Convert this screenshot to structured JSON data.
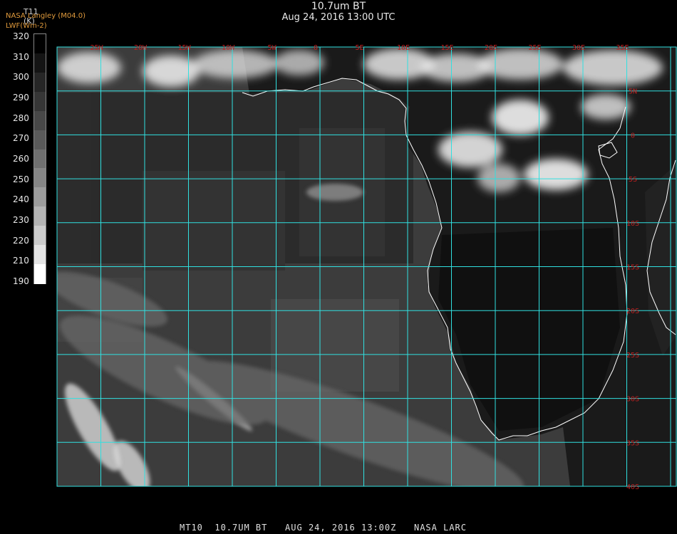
{
  "header": {
    "title": "10.7um BT",
    "subtitle": "Aug 24, 2016 13:00 UTC",
    "credit_line1": "NASA Langley (M04.0)",
    "credit_line2": "LWF(Wm-2)"
  },
  "legend": {
    "title": "T11",
    "unit": "(K)",
    "labels": [
      "320",
      "310",
      "300",
      "290",
      "280",
      "270",
      "260",
      "250",
      "240",
      "230",
      "220",
      "210",
      "190"
    ],
    "colors": [
      "#000000",
      "#141414",
      "#262626",
      "#363636",
      "#484848",
      "#5a5a5a",
      "#707070",
      "#868686",
      "#9c9c9c",
      "#b4b4b4",
      "#cccccc",
      "#e4e4e4",
      "#ffffff"
    ]
  },
  "map": {
    "colors": {
      "grid": "#30e0e0",
      "coast": "#ffffff",
      "label": "#c02020",
      "ocean": "#3c3c3c",
      "land": "#1a1a1a",
      "cloud": "#e8e8e8"
    },
    "lon_labels": [
      "25W",
      "20W",
      "15W",
      "10W",
      "5W",
      "0",
      "5E",
      "10E",
      "15E",
      "20E",
      "25E",
      "30E",
      "35E"
    ],
    "lat_labels": [
      "5N",
      "0",
      "5S",
      "10S",
      "15S",
      "20S",
      "25S",
      "30S",
      "35S",
      "40S"
    ]
  },
  "footer": {
    "text": "MT10  10.7UM BT   AUG 24, 2016 13:00Z   NASA LARC"
  }
}
